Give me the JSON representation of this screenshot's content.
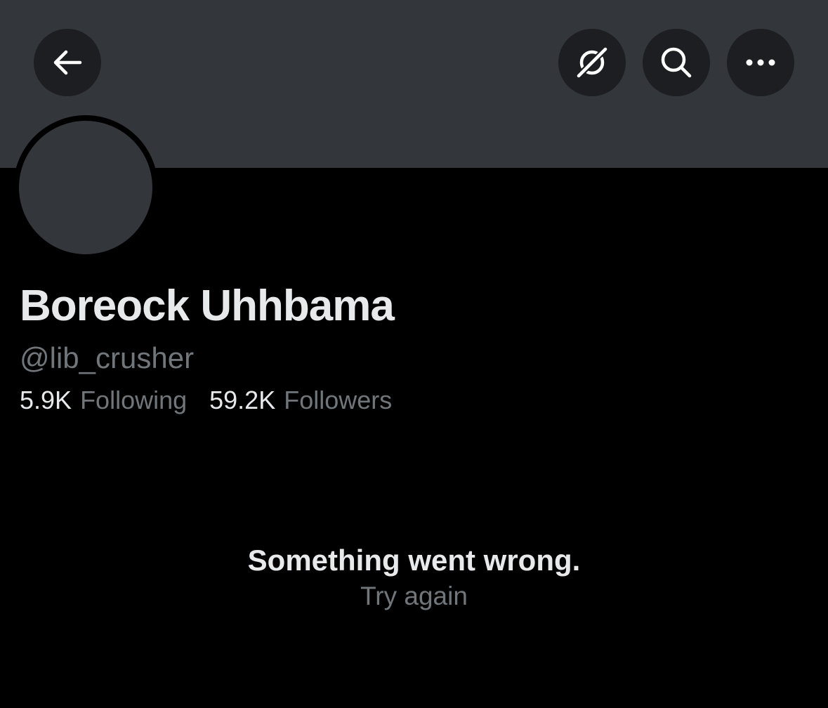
{
  "header": {
    "back_icon": "arrow-left-icon",
    "grok_icon": "grok-icon",
    "search_icon": "search-icon",
    "more_icon": "more-horizontal-icon",
    "banner_color": "#33363b"
  },
  "profile": {
    "display_name": "Boreock Uhhbama",
    "handle": "@lib_crusher",
    "following_count": "5.9K",
    "following_label": "Following",
    "followers_count": "59.2K",
    "followers_label": "Followers"
  },
  "error": {
    "title": "Something went wrong.",
    "retry_label": "Try again"
  },
  "colors": {
    "background": "#000000",
    "primary_text": "#e7e9ea",
    "secondary_text": "#71767b",
    "button_bg": "#1c1e21"
  }
}
